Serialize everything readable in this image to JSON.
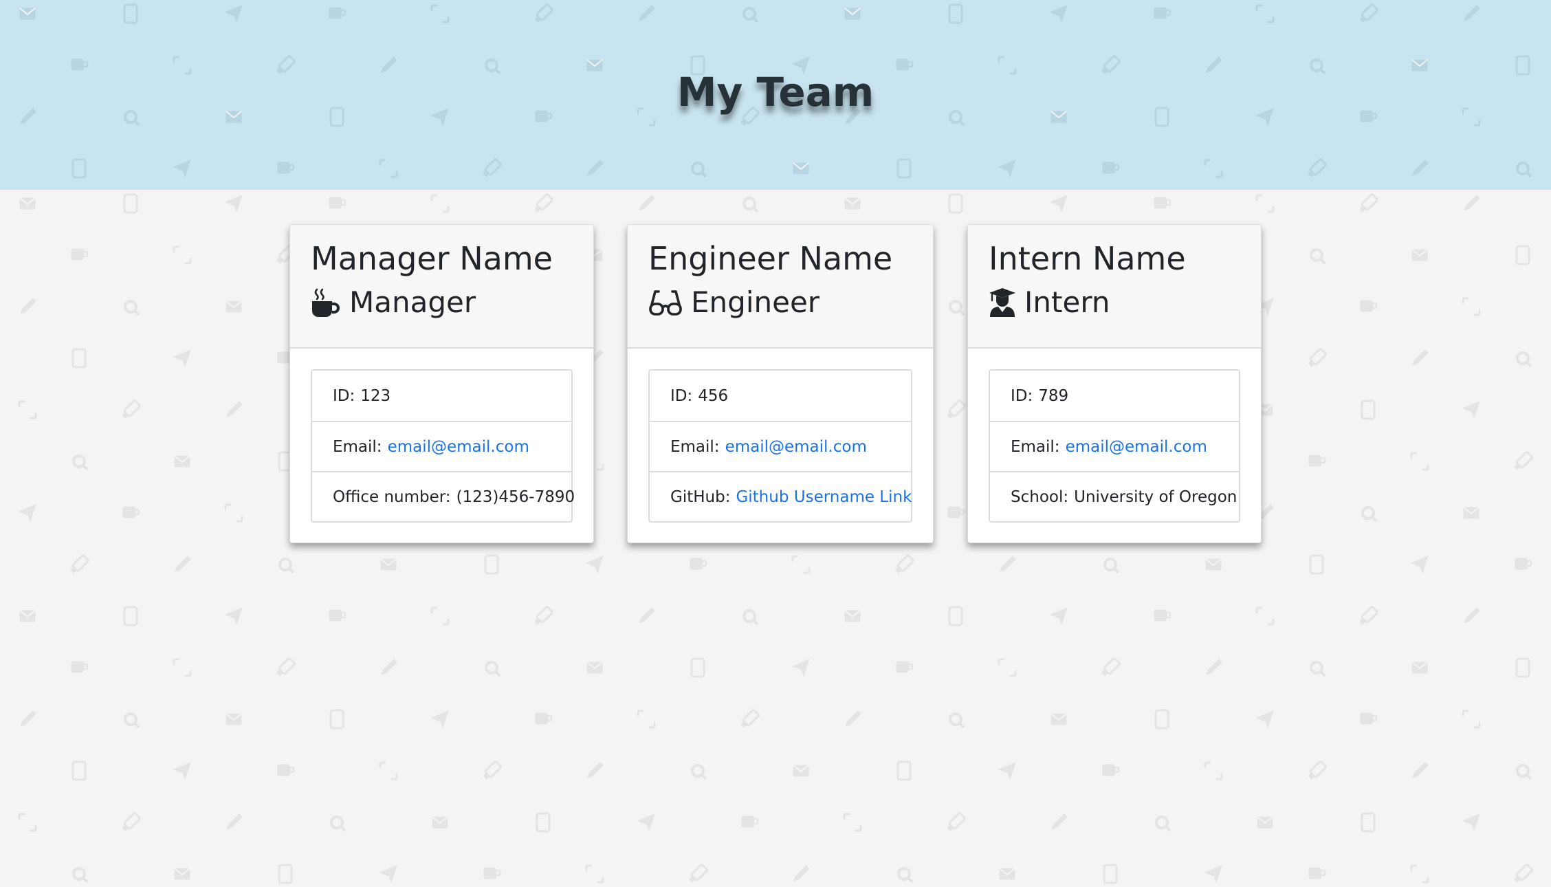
{
  "header": {
    "title": "My Team"
  },
  "colors": {
    "header_background": "#c8e4f0",
    "page_background": "#f4f4f4",
    "link": "#1a73e8",
    "card_header": "#f7f7f7"
  },
  "cards": [
    {
      "name": "Manager Name",
      "role": "Manager",
      "role_icon": "coffee-mug-icon",
      "id_label": "ID:",
      "id_value": "123",
      "email_label": "Email:",
      "email_value": "email@email.com",
      "extra_label": "Office number:",
      "extra_value": "(123)456-7890"
    },
    {
      "name": "Engineer Name",
      "role": "Engineer",
      "role_icon": "glasses-icon",
      "id_label": "ID:",
      "id_value": "456",
      "email_label": "Email:",
      "email_value": "email@email.com",
      "extra_label": "GitHub:",
      "extra_value": "Github Username Link"
    },
    {
      "name": "Intern Name",
      "role": "Intern",
      "role_icon": "graduate-icon",
      "id_label": "ID:",
      "id_value": "789",
      "email_label": "Email:",
      "email_value": "email@email.com",
      "extra_label": "School:",
      "extra_value": "University of Oregon"
    }
  ]
}
